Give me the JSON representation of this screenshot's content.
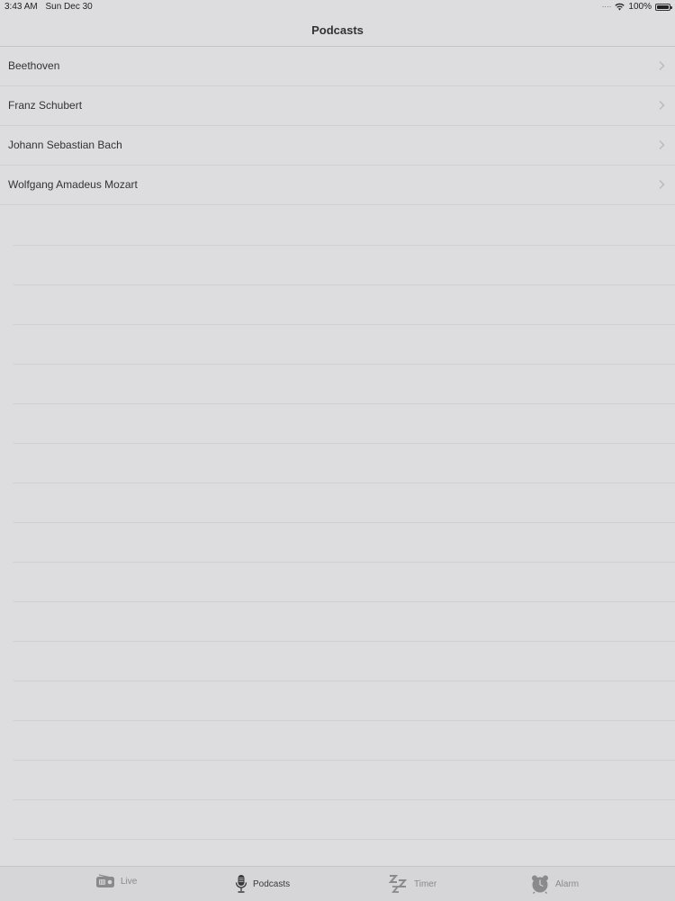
{
  "status_bar": {
    "time": "3:43 AM",
    "date": "Sun Dec 30",
    "battery": "100%",
    "battery_level": 1.0
  },
  "nav_bar": {
    "title": "Podcasts"
  },
  "list": {
    "items": [
      {
        "label": "Beethoven"
      },
      {
        "label": "Franz Schubert"
      },
      {
        "label": "Johann Sebastian Bach"
      },
      {
        "label": "Wolfgang Amadeus Mozart"
      }
    ]
  },
  "tab_bar": {
    "tabs": [
      {
        "label": "Live",
        "icon": "radio-icon",
        "active": false
      },
      {
        "label": "Podcasts",
        "icon": "microphone-icon",
        "active": true
      },
      {
        "label": "Timer",
        "icon": "sleep-zzz-icon",
        "active": false
      },
      {
        "label": "Alarm",
        "icon": "alarm-clock-icon",
        "active": false
      }
    ]
  },
  "colors": {
    "background": "#dddcde",
    "tab_inactive": "#8a898c",
    "tab_active": "#3a393c"
  }
}
